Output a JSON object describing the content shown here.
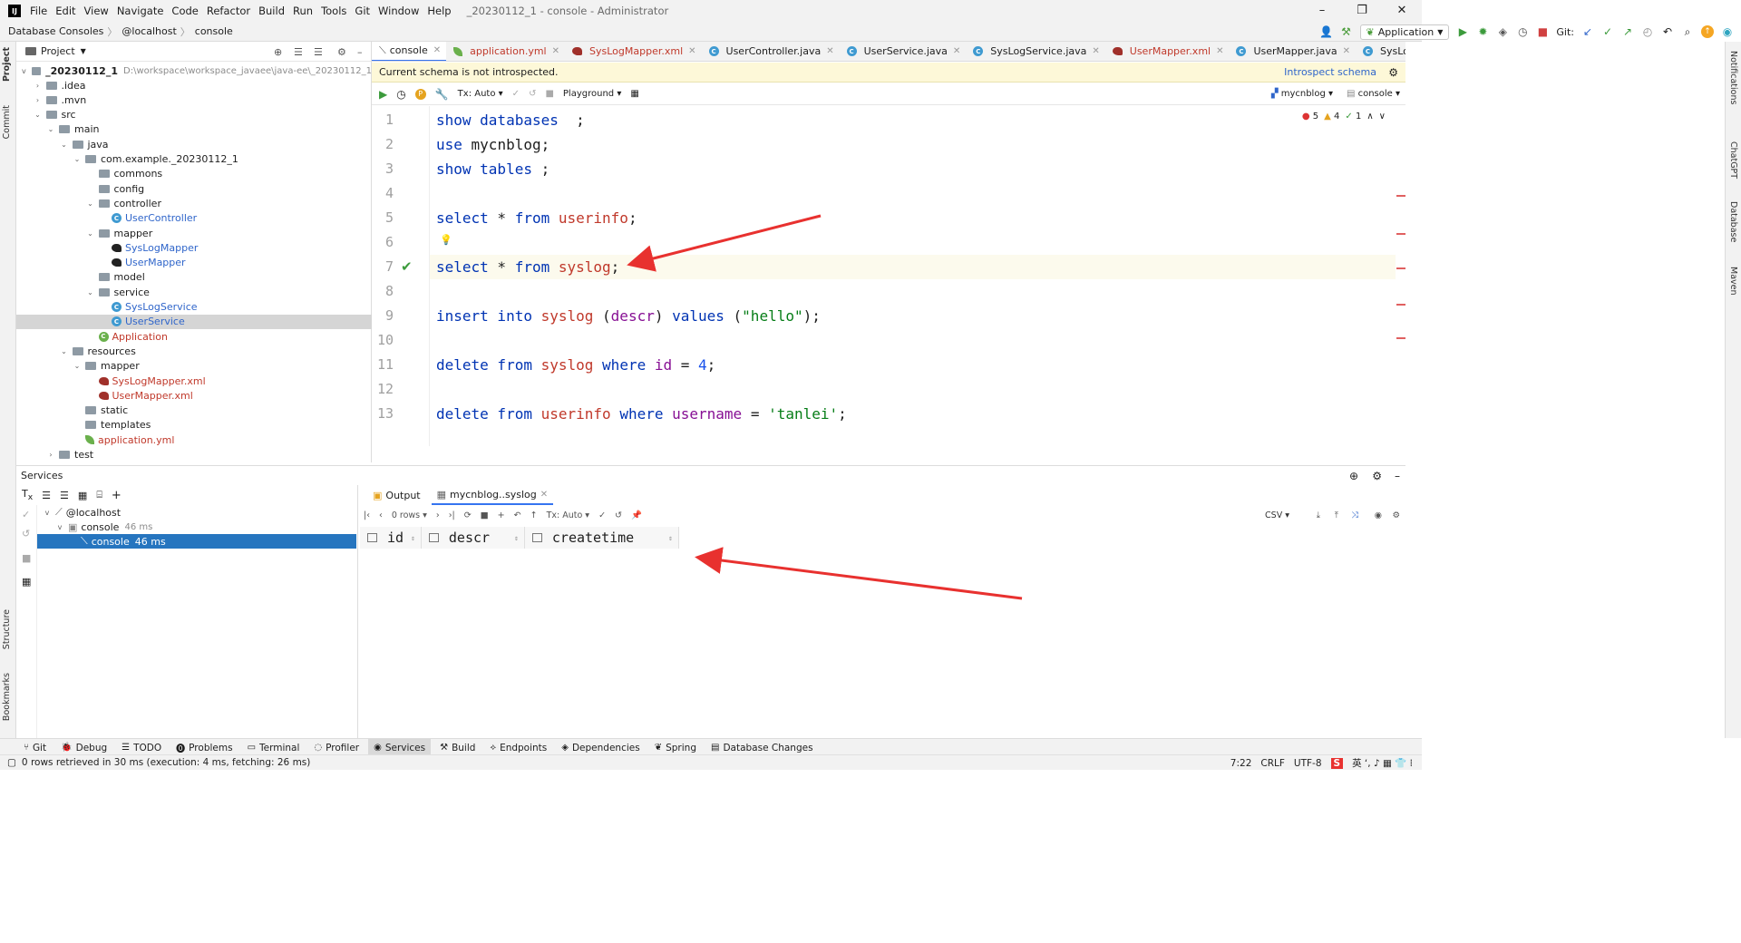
{
  "menubar": {
    "items": [
      "File",
      "Edit",
      "View",
      "Navigate",
      "Code",
      "Refactor",
      "Build",
      "Run",
      "Tools",
      "Git",
      "Window",
      "Help"
    ],
    "title": "_20230112_1 - console - Administrator",
    "logo": "IJ"
  },
  "breadcrumb": [
    "Database Consoles",
    "@localhost",
    "console"
  ],
  "toolbar": {
    "run_config": "Application",
    "git_label": "Git:"
  },
  "project": {
    "header": "Project",
    "root_name": "_20230112_1",
    "root_path": "D:\\workspace\\workspace_javaee\\java-ee\\_20230112_1",
    "items": [
      {
        "label": ".idea",
        "kind": "folder",
        "depth": 1,
        "arrow": ">"
      },
      {
        "label": ".mvn",
        "kind": "folder",
        "depth": 1,
        "arrow": ">"
      },
      {
        "label": "src",
        "kind": "folder",
        "depth": 1,
        "arrow": "v"
      },
      {
        "label": "main",
        "kind": "folder",
        "depth": 2,
        "arrow": "v"
      },
      {
        "label": "java",
        "kind": "folder",
        "depth": 3,
        "arrow": "v"
      },
      {
        "label": "com.example._20230112_1",
        "kind": "folder",
        "depth": 4,
        "arrow": "v"
      },
      {
        "label": "commons",
        "kind": "folder",
        "depth": 5,
        "arrow": ""
      },
      {
        "label": "config",
        "kind": "folder",
        "depth": 5,
        "arrow": ""
      },
      {
        "label": "controller",
        "kind": "folder",
        "depth": 5,
        "arrow": "v"
      },
      {
        "label": "UserController",
        "kind": "class",
        "depth": 6,
        "arrow": ""
      },
      {
        "label": "mapper",
        "kind": "folder",
        "depth": 5,
        "arrow": "v"
      },
      {
        "label": "SysLogMapper",
        "kind": "mapper",
        "depth": 6,
        "arrow": ""
      },
      {
        "label": "UserMapper",
        "kind": "mapper",
        "depth": 6,
        "arrow": ""
      },
      {
        "label": "model",
        "kind": "folder",
        "depth": 5,
        "arrow": ""
      },
      {
        "label": "service",
        "kind": "folder",
        "depth": 5,
        "arrow": "v"
      },
      {
        "label": "SysLogService",
        "kind": "class",
        "depth": 6,
        "arrow": ""
      },
      {
        "label": "UserService",
        "kind": "class",
        "depth": 6,
        "arrow": "",
        "selected": true
      },
      {
        "label": "Application",
        "kind": "app",
        "depth": 5,
        "arrow": ""
      },
      {
        "label": "resources",
        "kind": "folder",
        "depth": 3,
        "arrow": "v"
      },
      {
        "label": "mapper",
        "kind": "folder",
        "depth": 4,
        "arrow": "v"
      },
      {
        "label": "SysLogMapper.xml",
        "kind": "xml",
        "depth": 5,
        "arrow": ""
      },
      {
        "label": "UserMapper.xml",
        "kind": "xml",
        "depth": 5,
        "arrow": ""
      },
      {
        "label": "static",
        "kind": "folder",
        "depth": 4,
        "arrow": ""
      },
      {
        "label": "templates",
        "kind": "folder",
        "depth": 4,
        "arrow": ""
      },
      {
        "label": "application.yml",
        "kind": "yml",
        "depth": 4,
        "arrow": ""
      },
      {
        "label": "test",
        "kind": "folder",
        "depth": 2,
        "arrow": ">"
      }
    ]
  },
  "editor_tabs": [
    {
      "label": "console",
      "active": true
    },
    {
      "label": "application.yml"
    },
    {
      "label": "SysLogMapper.xml"
    },
    {
      "label": "UserController.java"
    },
    {
      "label": "UserService.java"
    },
    {
      "label": "SysLogService.java"
    },
    {
      "label": "UserMapper.xml"
    },
    {
      "label": "UserMapper.java"
    },
    {
      "label": "SysLogMapper.java"
    }
  ],
  "schema_bar": {
    "message": "Current schema is not introspected.",
    "link": "Introspect schema"
  },
  "editor_toolbar": {
    "tx": "Tx: Auto",
    "playground": "Playground",
    "schema": "mycnblog",
    "console": "console"
  },
  "inspections": {
    "errors": "5",
    "warnings": "4",
    "ok": "1"
  },
  "code_lines": [
    {
      "n": "1",
      "tokens": [
        [
          "kw",
          "show databases"
        ],
        [
          "",
          "  ;"
        ]
      ]
    },
    {
      "n": "2",
      "tokens": [
        [
          "kw",
          "use"
        ],
        [
          "",
          " mycnblog;"
        ]
      ]
    },
    {
      "n": "3",
      "tokens": [
        [
          "kw",
          "show tables"
        ],
        [
          "",
          " ;"
        ]
      ]
    },
    {
      "n": "4",
      "tokens": []
    },
    {
      "n": "5",
      "tokens": [
        [
          "kw",
          "select"
        ],
        [
          "",
          " * "
        ],
        [
          "kw",
          "from"
        ],
        [
          "",
          " "
        ],
        [
          "tb",
          "userinfo"
        ],
        [
          "",
          ";"
        ]
      ]
    },
    {
      "n": "6",
      "tokens": []
    },
    {
      "n": "7",
      "tokens": [
        [
          "kw",
          "select"
        ],
        [
          "",
          " * "
        ],
        [
          "kw",
          "from"
        ],
        [
          "",
          " "
        ],
        [
          "tb",
          "syslog"
        ],
        [
          "",
          ";"
        ]
      ],
      "current": true
    },
    {
      "n": "8",
      "tokens": []
    },
    {
      "n": "9",
      "tokens": [
        [
          "kw",
          "insert into"
        ],
        [
          "",
          " "
        ],
        [
          "tb",
          "syslog"
        ],
        [
          "",
          " ("
        ],
        [
          "col",
          "descr"
        ],
        [
          "",
          ") "
        ],
        [
          "kw",
          "values"
        ],
        [
          "",
          " ("
        ],
        [
          "str",
          "\"hello\""
        ],
        [
          "",
          ");"
        ]
      ]
    },
    {
      "n": "10",
      "tokens": []
    },
    {
      "n": "11",
      "tokens": [
        [
          "kw",
          "delete from"
        ],
        [
          "",
          " "
        ],
        [
          "tb",
          "syslog"
        ],
        [
          "",
          " "
        ],
        [
          "kw",
          "where"
        ],
        [
          "",
          " "
        ],
        [
          "col",
          "id"
        ],
        [
          "",
          " = "
        ],
        [
          "num",
          "4"
        ],
        [
          "",
          ";"
        ]
      ]
    },
    {
      "n": "12",
      "tokens": []
    },
    {
      "n": "13",
      "tokens": [
        [
          "kw",
          "delete from"
        ],
        [
          "",
          " "
        ],
        [
          "tb",
          "userinfo"
        ],
        [
          "",
          " "
        ],
        [
          "kw",
          "where"
        ],
        [
          "",
          " "
        ],
        [
          "col",
          "username"
        ],
        [
          "",
          " = "
        ],
        [
          "str",
          "'tanlei'"
        ],
        [
          "",
          ";"
        ]
      ]
    }
  ],
  "services": {
    "header": "Services",
    "tree": [
      {
        "label": "@localhost",
        "time": ""
      },
      {
        "label": "console",
        "time": "46 ms"
      },
      {
        "label": "console",
        "time": "46 ms",
        "selected": true
      }
    ],
    "tabs": [
      "Output",
      "mycnblog..syslog"
    ],
    "rows_label": "0 rows",
    "tx": "Tx: Auto",
    "format": "CSV",
    "columns": [
      "id",
      "descr",
      "createtime"
    ]
  },
  "bottom_tools": [
    "Git",
    "Debug",
    "TODO",
    "Problems",
    "Terminal",
    "Profiler",
    "Services",
    "Build",
    "Endpoints",
    "Dependencies",
    "Spring",
    "Database Changes"
  ],
  "status": {
    "message": "0 rows retrieved in 30 ms (execution: 4 ms, fetching: 26 ms)",
    "position": "7:22",
    "line_sep": "CRLF",
    "encoding": "UTF-8"
  },
  "side_labels": {
    "left": [
      "Project",
      "Commit",
      "Structure",
      "Bookmarks"
    ],
    "right": [
      "Notifications",
      "ChatGPT",
      "Database",
      "Maven"
    ]
  },
  "colors": {
    "accent": "#3574f0",
    "selection": "#2675bf",
    "annotation_arrow": "#e8312f"
  }
}
